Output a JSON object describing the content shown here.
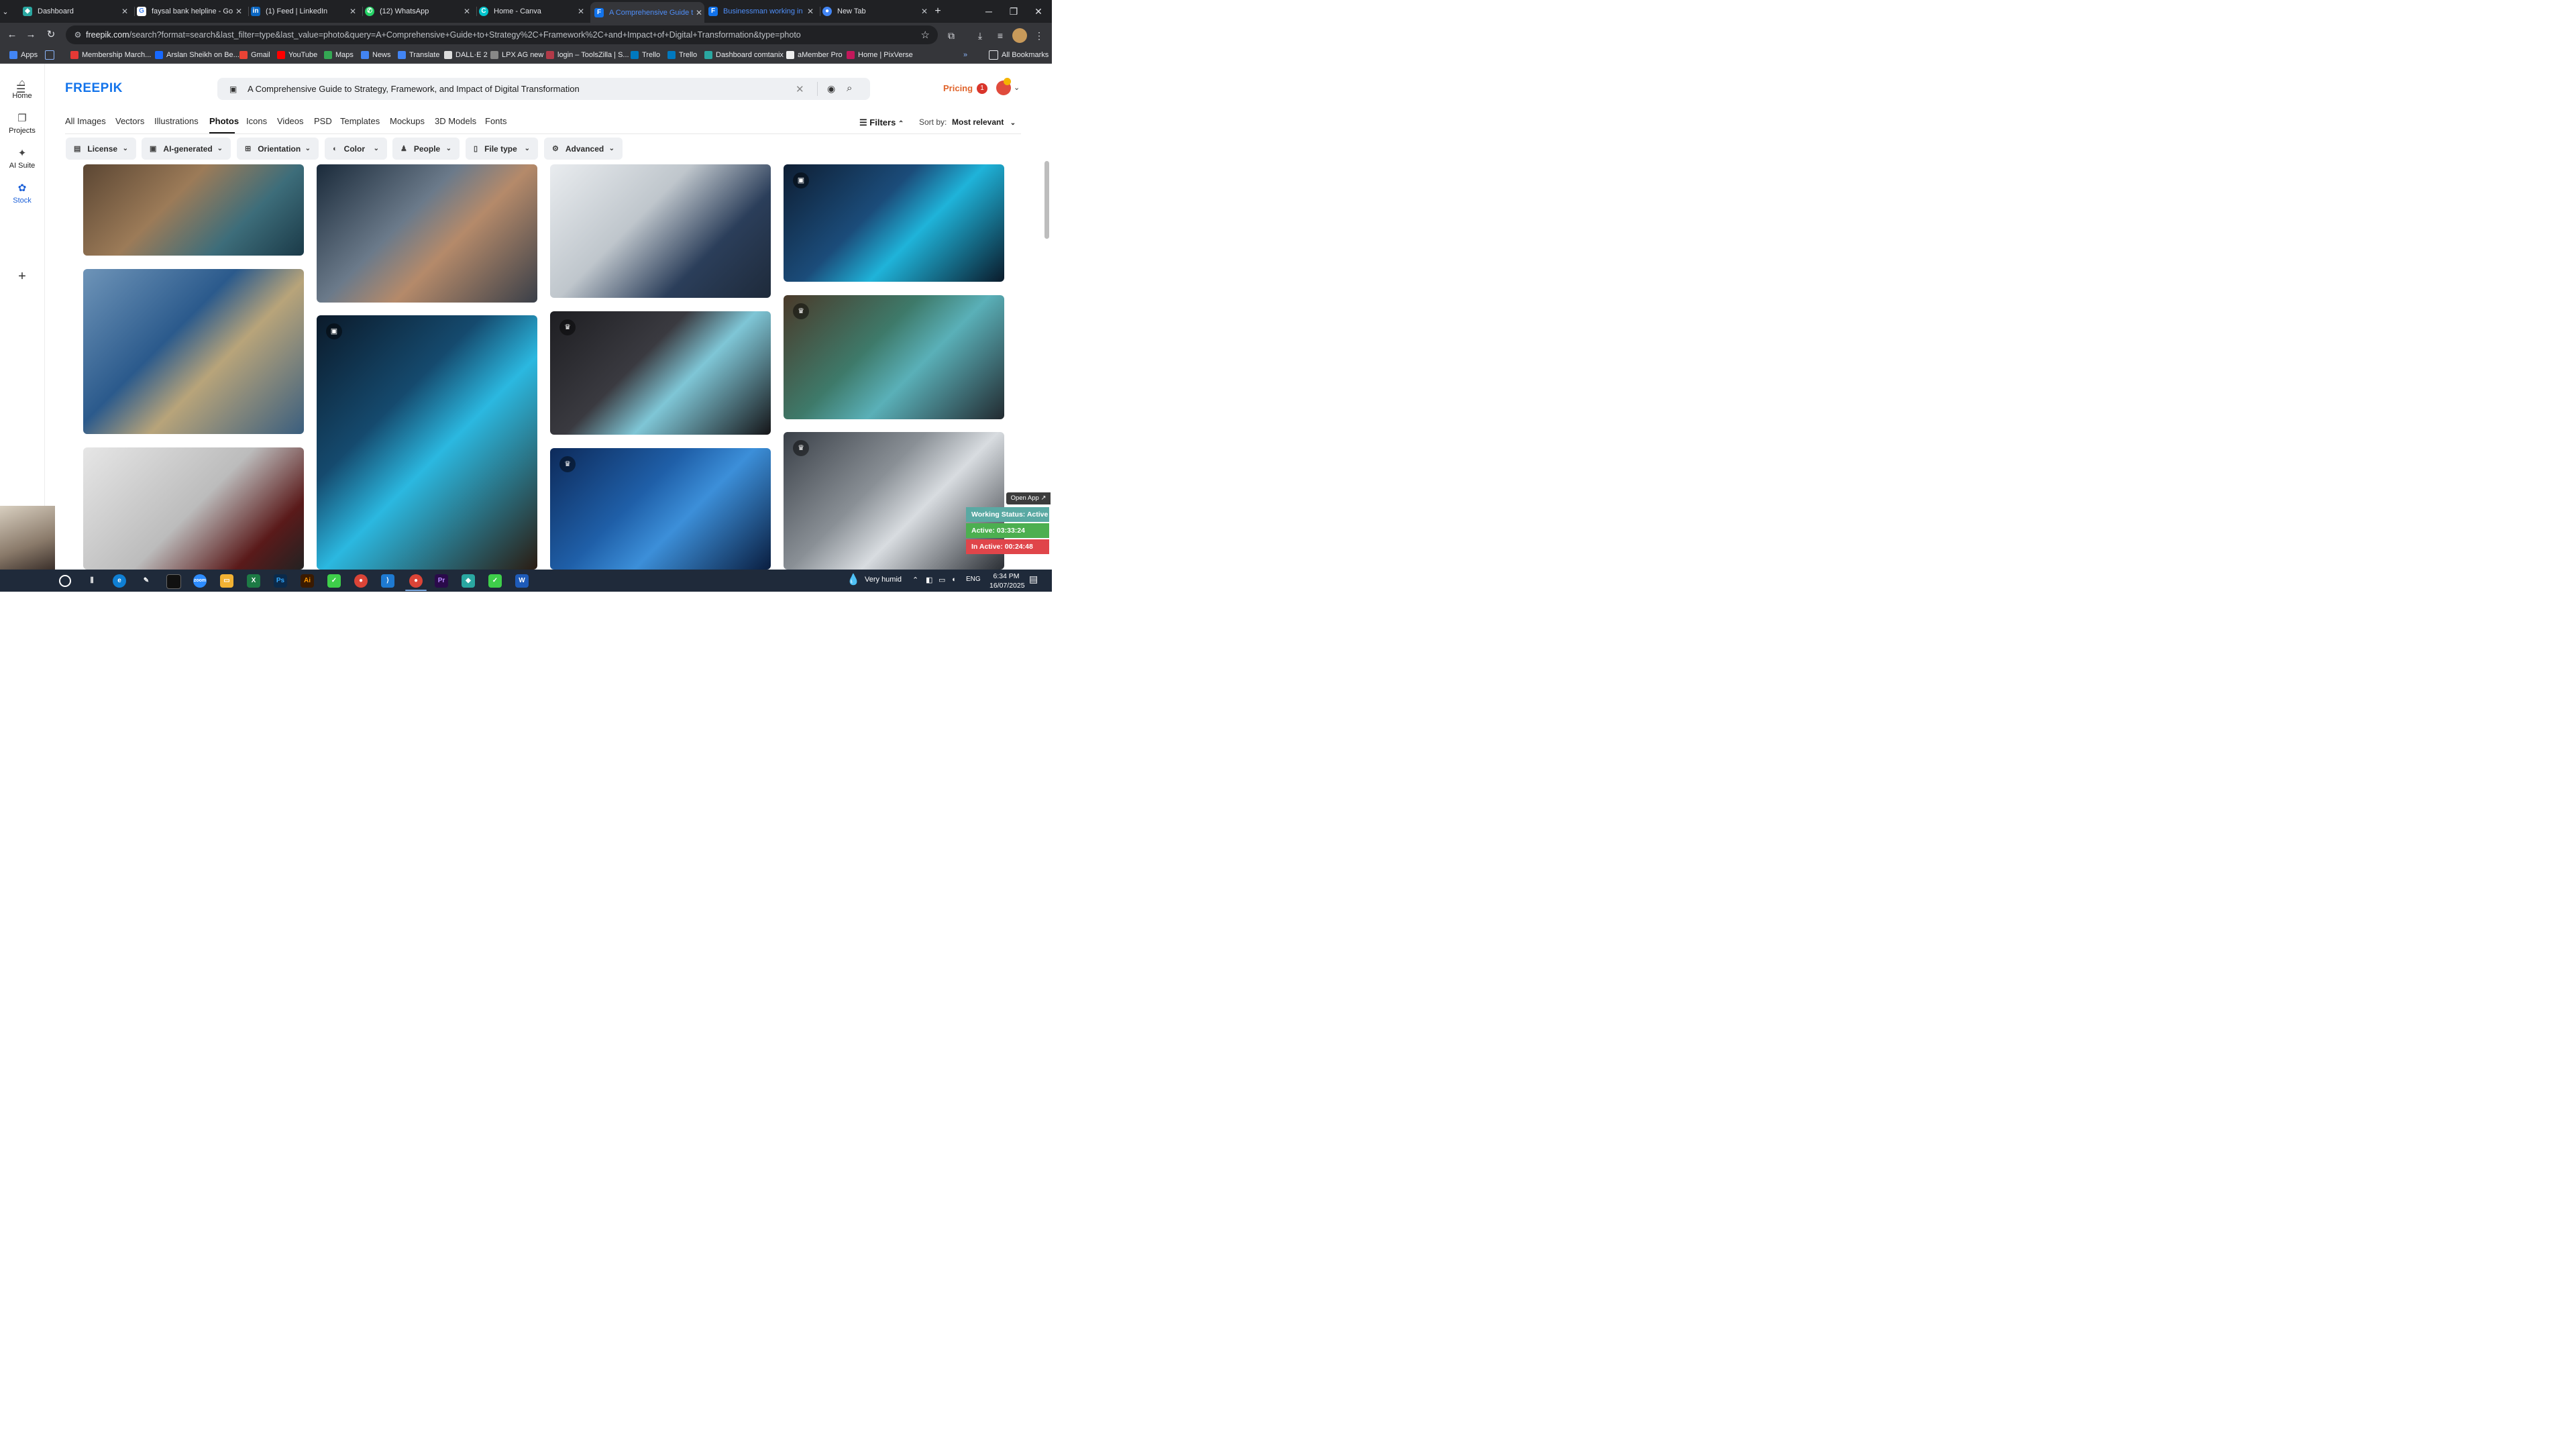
{
  "browser": {
    "tabs": [
      {
        "title": "Dashboard",
        "favicon": "dashboard-icon",
        "color": "#2aa7a1"
      },
      {
        "title": "faysal bank helpline - Go...",
        "favicon": "google-icon",
        "color": "#ffffff"
      },
      {
        "title": "(1) Feed | LinkedIn",
        "favicon": "linkedin-icon",
        "color": "#0a66c2"
      },
      {
        "title": "(12) WhatsApp",
        "favicon": "whatsapp-icon",
        "color": "#25d366"
      },
      {
        "title": "Home - Canva",
        "favicon": "canva-icon",
        "color": "#00c4cc"
      },
      {
        "title": "A Comprehensive Guide t...",
        "favicon": "freepik-icon",
        "color": "#1273eb"
      },
      {
        "title": "Businessman working in o...",
        "favicon": "freepik-icon",
        "color": "#1273eb"
      },
      {
        "title": "New Tab",
        "favicon": "chrome-icon",
        "color": "#4285f4"
      }
    ],
    "url_host": "freepik.com",
    "url_rest": "/search?format=search&last_filter=type&last_value=photo&query=A+Comprehensive+Guide+to+Strategy%2C+Framework%2C+and+Impact+of+Digital+Transformation&type=photo",
    "bookmarks": [
      {
        "label": "Apps",
        "color": "#4285f4"
      },
      {
        "label": "Membership March...",
        "color": "#e53935"
      },
      {
        "label": "Arslan Sheikh on Be...",
        "color": "#1769ff"
      },
      {
        "label": "Gmail",
        "color": "#ea4335"
      },
      {
        "label": "YouTube",
        "color": "#ff0000"
      },
      {
        "label": "Maps",
        "color": "#34a853"
      },
      {
        "label": "News",
        "color": "#4285f4"
      },
      {
        "label": "Translate",
        "color": "#4285f4"
      },
      {
        "label": "DALL·E 2",
        "color": "#dddddd"
      },
      {
        "label": "LPX AG new",
        "color": "#888888"
      },
      {
        "label": "login – ToolsZilla | S...",
        "color": "#b23a48"
      },
      {
        "label": "Trello",
        "color": "#0079bf"
      },
      {
        "label": "Trello",
        "color": "#0079bf"
      },
      {
        "label": "Dashboard comtanix",
        "color": "#2aa7a1"
      },
      {
        "label": "aMember Pro",
        "color": "#eeeeee"
      },
      {
        "label": "Home | PixVerse",
        "color": "#c2185b"
      }
    ],
    "all_bookmarks": "All Bookmarks"
  },
  "nav": [
    {
      "label": "Home",
      "icon": "home-icon"
    },
    {
      "label": "Projects",
      "icon": "projects-icon"
    },
    {
      "label": "AI Suite",
      "icon": "sparkle-icon"
    },
    {
      "label": "Stock",
      "icon": "stock-icon"
    }
  ],
  "header": {
    "logo": "FREEPIK",
    "search_query": "A Comprehensive Guide to Strategy, Framework, and Impact of Digital Transformation",
    "pricing": "Pricing",
    "notification_count": "1"
  },
  "type_tabs": [
    "All Images",
    "Vectors",
    "Illustrations",
    "Photos",
    "Icons",
    "Videos",
    "PSD",
    "Templates",
    "Mockups",
    "3D Models",
    "Fonts"
  ],
  "active_tab": "Photos",
  "filters_label": "Filters",
  "sort": {
    "label": "Sort by:",
    "value": "Most relevant"
  },
  "filter_chips": [
    {
      "label": "License",
      "icon": "license-icon"
    },
    {
      "label": "AI-generated",
      "icon": "ai-icon"
    },
    {
      "label": "Orientation",
      "icon": "orientation-icon"
    },
    {
      "label": "Color",
      "icon": "color-icon"
    },
    {
      "label": "People",
      "icon": "people-icon"
    },
    {
      "label": "File type",
      "icon": "file-icon"
    },
    {
      "label": "Advanced",
      "icon": "advanced-icon"
    }
  ],
  "images": [
    {
      "bg": "linear-gradient(135deg,#5b4633,#9c7b58 40%,#3d6d7a 70%,#1b3a48)",
      "badge": ""
    },
    {
      "bg": "linear-gradient(135deg,#1a2a3a,#6b7a8a 40%,#b58a6a 60%,#3a3f48)",
      "badge": ""
    },
    {
      "bg": "linear-gradient(135deg,#e9ecef,#bfc6cc 40%,#2b3e5a 70%,#1e2a3a)",
      "badge": ""
    },
    {
      "bg": "linear-gradient(135deg,#0e1e33,#1b4c7a 40%,#1fb3d9 60%,#0a1a2a)",
      "badge": "ai-icon"
    },
    {
      "bg": "linear-gradient(135deg,#6e94b8,#2b5a8c 40%,#b8a47a 60%,#3a5e7e)",
      "badge": ""
    },
    {
      "bg": "linear-gradient(135deg,#0b1a2a,#154a6e 35%,#2bb8e0 55%,#2a1c12)",
      "badge": "ai-icon"
    },
    {
      "bg": "linear-gradient(135deg,#1e1e22,#3a3a40 40%,#7fc6d6 60%,#151518)",
      "badge": "crown-icon"
    },
    {
      "bg": "linear-gradient(135deg,#4a3a2a,#3e7a6a 40%,#5ab0b8 60%,#222a30)",
      "badge": "crown-icon"
    },
    {
      "bg": "linear-gradient(135deg,#e6e6e6,#bcbcbc 50%,#5a1a1a 80%,#222)",
      "badge": ""
    },
    {
      "bg": "linear-gradient(135deg,#0d2a5a,#1f5fa8 40%,#3c8fd9 60%,#0a1e40)",
      "badge": "crown-icon"
    },
    {
      "bg": "linear-gradient(135deg,#3a4048,#8a9096 40%,#d8dce0 60%,#2a2e34)",
      "badge": "crown-icon"
    }
  ],
  "work_status": {
    "open_app": "Open App ↗",
    "status": "Working Status: Active",
    "active": "Active: 03:33:24",
    "inactive": "In Active: 00:24:48"
  },
  "taskbar": {
    "weather": "Very humid",
    "lang": "ENG",
    "time": "6:34 PM",
    "date": "16/07/2025",
    "apps": [
      {
        "name": "search-icon",
        "color": "#1f2a3a"
      },
      {
        "name": "task-view-icon",
        "color": "#1f2a3a"
      },
      {
        "name": "edge-icon",
        "color": "#0f7fd3"
      },
      {
        "name": "pen-icon",
        "color": "#1f2a3a"
      },
      {
        "name": "terminal-icon",
        "color": "#111111"
      },
      {
        "name": "zoom-icon",
        "color": "#2d8cff"
      },
      {
        "name": "file-explorer-icon",
        "color": "#f2b233"
      },
      {
        "name": "excel-icon",
        "color": "#1d7a45"
      },
      {
        "name": "photoshop-icon",
        "color": "#0b2a4a"
      },
      {
        "name": "illustrator-icon",
        "color": "#3a1a00"
      },
      {
        "name": "app-green-icon",
        "color": "#3ecf4a"
      },
      {
        "name": "chrome-icon",
        "color": "#db4437"
      },
      {
        "name": "vscode-icon",
        "color": "#1e7ad1"
      },
      {
        "name": "chrome-profile-icon",
        "color": "#db4437"
      },
      {
        "name": "premiere-icon",
        "color": "#2a0a4a"
      },
      {
        "name": "app-teal-icon",
        "color": "#2aa7a1"
      },
      {
        "name": "app-green2-icon",
        "color": "#3ecf4a"
      },
      {
        "name": "word-icon",
        "color": "#1e5bb8"
      }
    ]
  }
}
